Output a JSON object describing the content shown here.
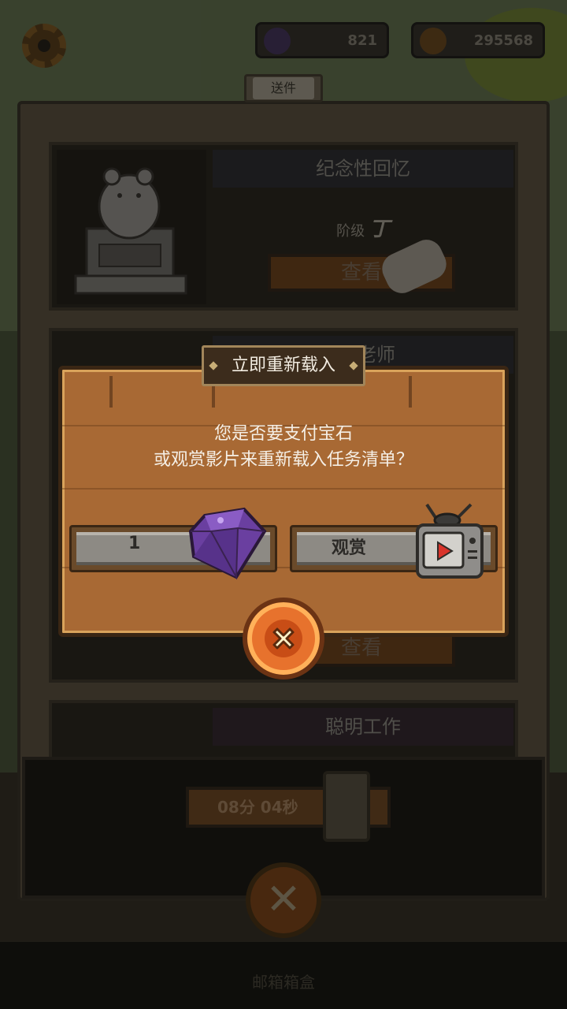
{
  "hud": {
    "gems": "821",
    "coins": "295568"
  },
  "mail": {
    "tab_label": "送件",
    "cards": [
      {
        "title": "纪念性回忆",
        "rank_label": "阶级",
        "rank_value": "丁",
        "view_label": "查看"
      },
      {
        "title": "老师",
        "view_label": "查看"
      },
      {
        "title": "聪明工作"
      }
    ],
    "timer": "08分 04秒",
    "bottom_label": "邮箱箱盒"
  },
  "dialog": {
    "title": "立即重新载入",
    "message_line1": "您是否要支付宝石",
    "message_line2": "或观赏影片来重新载入任务清单？",
    "gem_cost": "1",
    "watch_label": "观赏"
  },
  "colors": {
    "dialog_wood": "#a86934",
    "close_orange": "#e7722d",
    "gem_purple": "#6a3fa0"
  },
  "icons": [
    "settings-gear-icon",
    "gem-icon",
    "coin-icon",
    "scroll-icon",
    "hourglass-icon",
    "tv-icon",
    "close-icon"
  ]
}
